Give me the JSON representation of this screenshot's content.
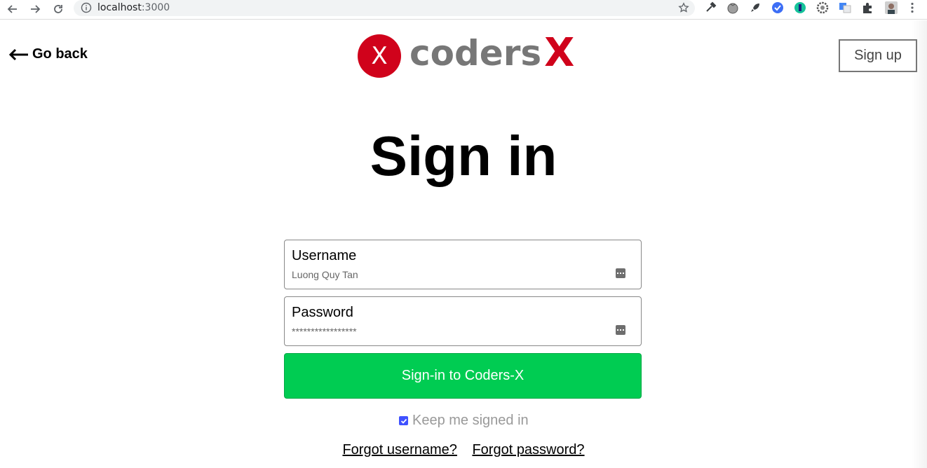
{
  "browser": {
    "url_host": "localhost",
    "url_port": ":3000",
    "icons": [
      "back-icon",
      "forward-icon",
      "reload-icon",
      "info-icon",
      "star-icon",
      "eyedropper-icon",
      "tomato-icon",
      "rocket-icon",
      "check-circle-icon",
      "grammarly-icon",
      "gear-icon",
      "translate-icon",
      "puzzle-icon",
      "avatar",
      "kebab-menu-icon"
    ]
  },
  "header": {
    "go_back_label": "Go back",
    "logo_letter": "X",
    "logo_text": "coders",
    "logo_x": "X",
    "signup_label": "Sign up"
  },
  "title": "Sign in",
  "form": {
    "username_label": "Username",
    "username_value": "Luong Quy Tan",
    "password_label": "Password",
    "password_value": "*****************",
    "submit_label": "Sign-in to Coders-X",
    "keep_signed_label": "Keep me signed in",
    "keep_signed_checked": true,
    "forgot_username": "Forgot username?",
    "forgot_password": "Forgot password?"
  },
  "colors": {
    "brand_red": "#d0021b",
    "submit_green": "#00cc52",
    "checkbox_blue": "#3f51ff"
  }
}
